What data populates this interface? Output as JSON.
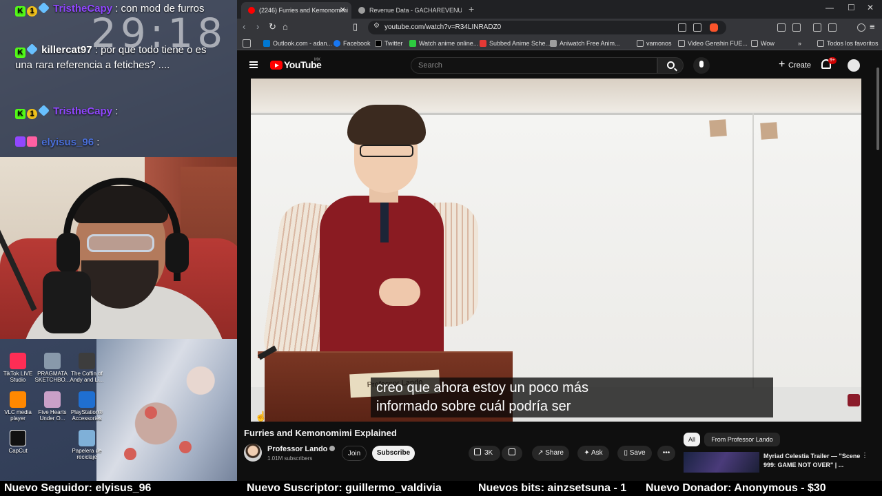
{
  "overlay": {
    "clock": "29:18",
    "chat": [
      {
        "user": "TristheCapy",
        "message": ": con mod de furros",
        "user_color": "#9147ff"
      },
      {
        "user": "killercat97",
        "message": ": por que todo tiene o es una rara referencia a fetiches? ....",
        "user_color": "#ffffff"
      },
      {
        "user": "TristheCapy",
        "message": ":",
        "user_color": "#9147ff"
      },
      {
        "user": "elyisus_96",
        "message": ":",
        "user_color": "#4a6fd8"
      }
    ],
    "desktop_icons": [
      {
        "label": "TikTok LIVE Studio",
        "color": "#ff2d55"
      },
      {
        "label": "PRAGMATA SKETCHBO...",
        "color": "#8899aa"
      },
      {
        "label": "The Coffin of Andy and Li...",
        "color": "#3d3d3d"
      },
      {
        "label": "VLC media player",
        "color": "#ff8800"
      },
      {
        "label": "Five Hearts Under O...",
        "color": "#c9a0c8"
      },
      {
        "label": "PlayStation® Accessories",
        "color": "#1f6fd1"
      },
      {
        "label": "CapCut",
        "color": "#111111"
      },
      {
        "label": "Papelera de reciclaje",
        "color": "#7fb0d8"
      }
    ]
  },
  "browser": {
    "tabs": [
      {
        "label": "(2246) Furries and Kemonomimi",
        "active": true,
        "favicon_color": "#ff0000"
      },
      {
        "label": "Revenue Data - GACHAREVENUE",
        "active": false,
        "favicon_color": "#9e9e9e"
      }
    ],
    "url": "youtube.com/watch?v=R34LINRADZ0",
    "bookmarks": [
      {
        "label": "Outlook.com - adan...",
        "color": "#0078d4"
      },
      {
        "label": "Facebook",
        "color": "#1877f2"
      },
      {
        "label": "Twitter",
        "color": "#000000"
      },
      {
        "label": "Watch anime online...",
        "color": "#2ecc40"
      },
      {
        "label": "Subbed Anime Sche...",
        "color": "#e53935"
      },
      {
        "label": "Aniwatch Free Anim...",
        "color": "#9e9e9e"
      },
      {
        "label": "vamonos",
        "color": "#9e9e9e"
      },
      {
        "label": "Video Genshin FUE...",
        "color": "#9e9e9e"
      },
      {
        "label": "Wow",
        "color": "#9e9e9e"
      },
      {
        "label": "Todos los favoritos",
        "color": "#9e9e9e"
      }
    ]
  },
  "youtube": {
    "logo_text": "YouTube",
    "region": "MX",
    "search_placeholder": "Search",
    "create_label": "Create",
    "notif_count": "9+",
    "subtitle_line1": "creo que ahora estoy un poco más",
    "subtitle_line2": "informado sobre cuál podría ser",
    "name_plate": "Professor Lando",
    "video_title": "Furries and Kemonomimi Explained",
    "channel_name": "Professor Lando",
    "subscribers": "1.01M subscribers",
    "join_label": "Join",
    "subscribe_label": "Subscribe",
    "likes": "3K",
    "share_label": "Share",
    "ask_label": "Ask",
    "save_label": "Save",
    "chips": [
      "All",
      "From Professor Lando"
    ],
    "recommended_title": "Myriad Celestia Trailer — \"Scene 999: GAME NOT OVER\" | ..."
  },
  "ticker": [
    "Nuevo Seguidor: elyisus_96",
    "Nuevo Suscriptor: guillermo_valdivia",
    "Nuevos bits: ainzsetsuna - 1",
    "Nuevo Donador: Anonymous - $30"
  ]
}
